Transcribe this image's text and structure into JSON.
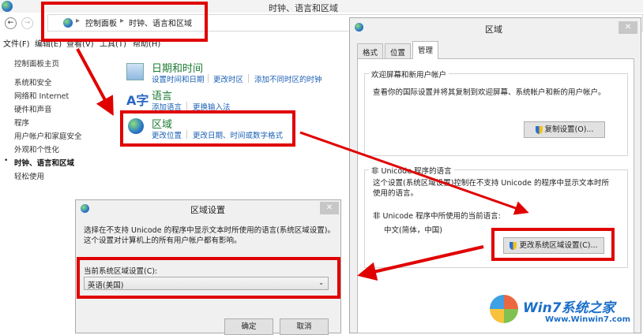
{
  "main_window": {
    "title": "时钟、语言和区域",
    "breadcrumb": [
      "控制面板",
      "时钟、语言和区域"
    ],
    "menu": [
      "文件(F)",
      "编辑(E)",
      "查看(V)",
      "工具(T)",
      "帮助(H)"
    ],
    "sidebar": {
      "home": "控制面板主页",
      "items": [
        "系统和安全",
        "网络和 Internet",
        "硬件和声音",
        "程序",
        "用户帐户和家庭安全",
        "外观和个性化",
        "时钟、语言和区域",
        "轻松使用"
      ]
    },
    "categories": [
      {
        "title": "日期和时间",
        "links": [
          "设置时间和日期",
          "更改时区",
          "添加不同时区的时钟"
        ]
      },
      {
        "title": "语言",
        "links": [
          "添加语言",
          "更换输入法"
        ]
      },
      {
        "title": "区域",
        "links": [
          "更改位置",
          "更改日期、时间或数字格式"
        ]
      }
    ]
  },
  "region_dialog": {
    "title": "区域",
    "tabs": [
      "格式",
      "位置",
      "管理"
    ],
    "active_tab": "管理",
    "welcome": {
      "label": "欢迎屏幕和新用户帐户",
      "text": "查看你的国际设置并将其复制到欢迎屏幕、系统帐户和新的用户帐户。",
      "button": "复制设置(O)..."
    },
    "unicode": {
      "label": "非 Unicode 程序的语言",
      "text": "这个设置(系统区域设置)控制在不支持 Unicode 的程序中显示文本时所使用的语言。",
      "current_label": "非 Unicode 程序中所使用的当前语言:",
      "current_value": "中文(简体，中国)",
      "button": "更改系统区域设置(C)..."
    }
  },
  "locale_dialog": {
    "title": "区域设置",
    "text": "选择在不支持 Unicode 的程序中显示文本时所使用的语言(系统区域设置)。这个设置对计算机上的所有用户帐户都有影响。",
    "select_label": "当前系统区域设置(C):",
    "select_value": "英语(美国)",
    "ok": "确定",
    "cancel": "取消"
  },
  "watermark": {
    "brand": "Win7系统之家",
    "url": "Www.Winwin7.com"
  },
  "colors": {
    "annotation": "#e00000",
    "link": "#1a5fb4",
    "category": "#1e7c35"
  }
}
